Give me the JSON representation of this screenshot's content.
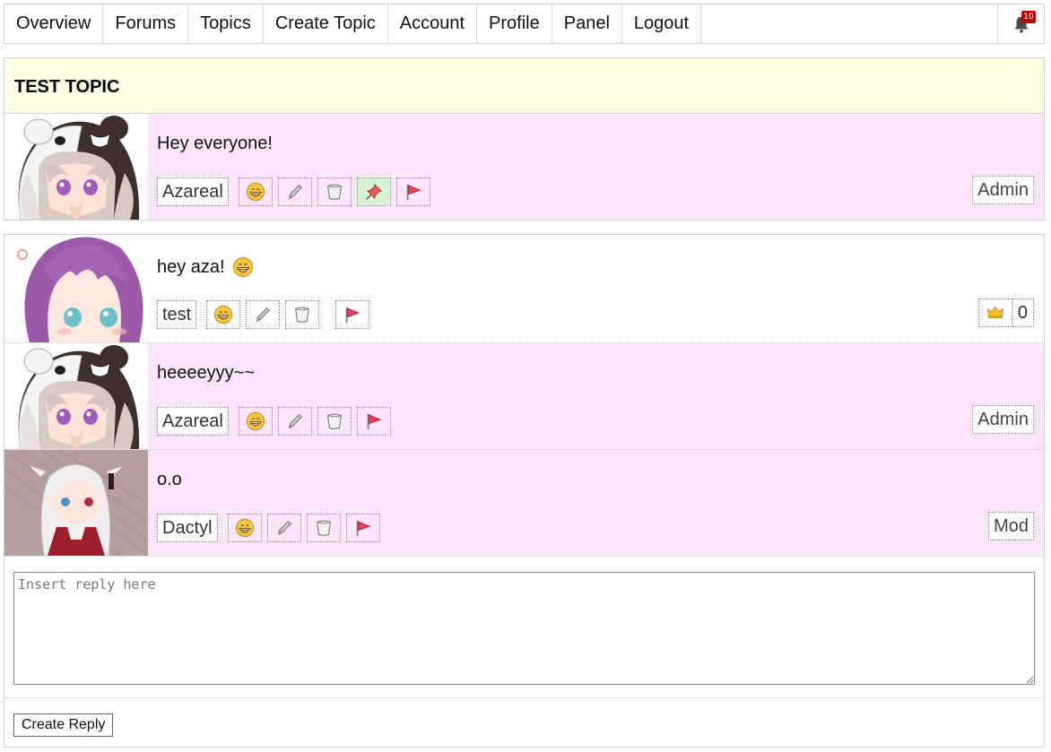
{
  "nav": {
    "items": [
      "Overview",
      "Forums",
      "Topics",
      "Create Topic",
      "Account",
      "Profile",
      "Panel",
      "Logout"
    ],
    "notification_count": "10"
  },
  "topic": {
    "title": "TEST TOPIC",
    "opening_post": {
      "text": "Hey everyone!",
      "author": "Azareal",
      "role": "Admin",
      "avatar": "white-bear-hood-girl",
      "actions": [
        "like-emoji",
        "edit-pencil",
        "delete-trash",
        "pin",
        "report-flag"
      ],
      "pinned": true
    }
  },
  "replies": [
    {
      "text": "hey aza!",
      "has_emoji": true,
      "author": "test",
      "avatar": "purple-hair-girl",
      "actions": [
        "like-emoji",
        "edit-pencil",
        "delete-trash",
        "report-flag"
      ],
      "like_count": "0",
      "style": "white"
    },
    {
      "text": "heeeeyyy~~",
      "author": "Azareal",
      "role": "Admin",
      "avatar": "white-bear-hood-girl",
      "actions": [
        "like-emoji",
        "edit-pencil",
        "delete-trash",
        "report-flag"
      ],
      "style": "pink"
    },
    {
      "text": "o.o",
      "author": "Dactyl",
      "role": "Mod",
      "avatar": "white-hair-girl",
      "actions": [
        "like-emoji",
        "edit-pencil",
        "delete-trash",
        "report-flag"
      ],
      "style": "pink"
    }
  ],
  "reply_form": {
    "placeholder": "Insert reply here",
    "submit_label": "Create Reply"
  },
  "colors": {
    "title_bg": "#fefde4",
    "post_pink": "#fde6fd",
    "pin_active": "#d6f3d6",
    "badge_red": "#c40000"
  }
}
